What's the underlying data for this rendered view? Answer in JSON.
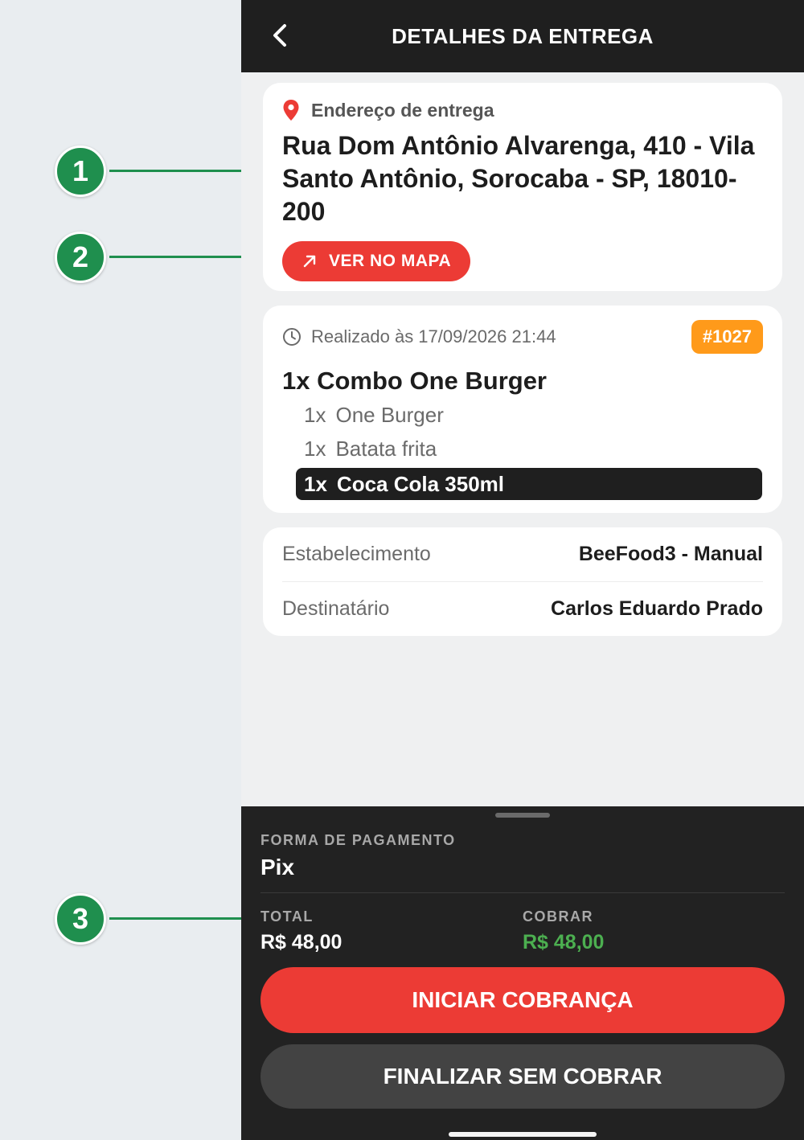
{
  "annotations": [
    "1",
    "2",
    "3"
  ],
  "header": {
    "title": "DETALHES DA ENTREGA",
    "back_icon": "chevron-left-icon"
  },
  "address": {
    "label": "Endereço de entrega",
    "icon": "map-pin-icon",
    "text": "Rua Dom Antônio Alvarenga, 410 - Vila Santo Antônio, Sorocaba - SP, 18010-200",
    "map_button": "VER NO MAPA"
  },
  "order": {
    "time": "Realizado às 17/09/2026 21:44",
    "badge": "#1027",
    "combo": "1x Combo One Burger",
    "items": [
      {
        "qty": "1x",
        "name": "One Burger"
      },
      {
        "qty": "1x",
        "name": "Batata frita"
      },
      {
        "qty": "1x",
        "name": "Coca Cola 350ml"
      }
    ]
  },
  "info": {
    "rows": [
      {
        "label": "Estabelecimento",
        "value": "BeeFood3 - Manual"
      },
      {
        "label": "Destinatário",
        "value": "Carlos Eduardo Prado"
      }
    ]
  },
  "payment": {
    "method_label": "FORMA DE PAGAMENTO",
    "method": "Pix",
    "total_label": "TOTAL",
    "total": "R$ 48,00",
    "charge_label": "COBRAR",
    "charge": "R$ 48,00",
    "primary_button": "INICIAR COBRANÇA",
    "secondary_button": "FINALIZAR SEM COBRAR"
  },
  "colors": {
    "accent_red": "#ec3b35",
    "badge_orange": "#ff9a1a",
    "charge_green": "#4caf50",
    "annotation_green": "#1f8f4e",
    "dark_bar": "#1f1f1f"
  }
}
